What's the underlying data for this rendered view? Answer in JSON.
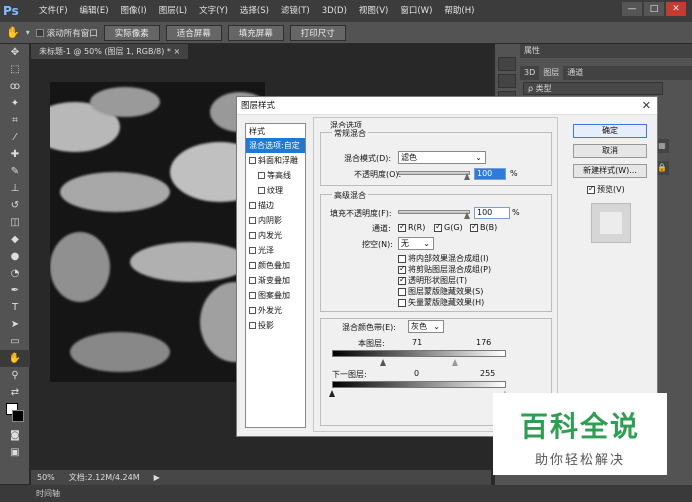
{
  "app": {
    "logo": "Ps"
  },
  "menu": [
    "文件(F)",
    "编辑(E)",
    "图像(I)",
    "图层(L)",
    "文字(Y)",
    "选择(S)",
    "滤镜(T)",
    "3D(D)",
    "视图(V)",
    "窗口(W)",
    "帮助(H)"
  ],
  "window_buttons": {
    "minimize": "—",
    "maximize": "□",
    "close": "✕"
  },
  "options_bar": {
    "scroll_all_label": "滚动所有窗口",
    "buttons": [
      "实际像素",
      "适合屏幕",
      "填充屏幕",
      "打印尺寸"
    ]
  },
  "document": {
    "tab": "未标题-1 @ 50% (图层 1, RGB/8) *  ×"
  },
  "status": {
    "zoom": "50%",
    "doc": "文档:2.12M/4.24M"
  },
  "bottom": {
    "timeline": "时间轴"
  },
  "right_panel": {
    "tab_top": "属性",
    "tabs": [
      "3D",
      "图层",
      "通道"
    ],
    "filter_placeholder": "ρ 类型"
  },
  "dialog": {
    "title": "图层样式",
    "close": "✕",
    "styles_header": "样式",
    "styles": [
      {
        "label": "混合选项:自定",
        "checked": null,
        "selected": true,
        "indent": false
      },
      {
        "label": "斜面和浮雕",
        "checked": false,
        "selected": false,
        "indent": false
      },
      {
        "label": "等高线",
        "checked": false,
        "selected": false,
        "indent": true
      },
      {
        "label": "纹理",
        "checked": false,
        "selected": false,
        "indent": true
      },
      {
        "label": "描边",
        "checked": false,
        "selected": false,
        "indent": false
      },
      {
        "label": "内阴影",
        "checked": false,
        "selected": false,
        "indent": false
      },
      {
        "label": "内发光",
        "checked": false,
        "selected": false,
        "indent": false
      },
      {
        "label": "光泽",
        "checked": false,
        "selected": false,
        "indent": false
      },
      {
        "label": "颜色叠加",
        "checked": false,
        "selected": false,
        "indent": false
      },
      {
        "label": "渐变叠加",
        "checked": false,
        "selected": false,
        "indent": false
      },
      {
        "label": "图案叠加",
        "checked": false,
        "selected": false,
        "indent": false
      },
      {
        "label": "外发光",
        "checked": false,
        "selected": false,
        "indent": false
      },
      {
        "label": "投影",
        "checked": false,
        "selected": false,
        "indent": false
      }
    ],
    "blend_options_title": "混合选项",
    "general_blend": "常规混合",
    "blend_mode_label": "混合模式(D):",
    "blend_mode_value": "滤色",
    "opacity_label": "不透明度(O):",
    "opacity_value": "100",
    "percent": "%",
    "advanced_blend": "高级混合",
    "fill_opacity_label": "填充不透明度(F):",
    "fill_opacity_value": "100",
    "channels_label": "通道:",
    "channels": [
      {
        "label": "R(R)",
        "checked": true
      },
      {
        "label": "G(G)",
        "checked": true
      },
      {
        "label": "B(B)",
        "checked": true
      }
    ],
    "knockout_label": "挖空(N):",
    "knockout_value": "无",
    "adv_checks": [
      {
        "label": "将内部效果混合成组(I)",
        "checked": false
      },
      {
        "label": "将剪贴图层混合成组(P)",
        "checked": true
      },
      {
        "label": "透明形状图层(T)",
        "checked": true
      },
      {
        "label": "图层蒙版隐藏效果(S)",
        "checked": false
      },
      {
        "label": "矢量蒙版隐藏效果(H)",
        "checked": false
      }
    ],
    "blend_if_label": "混合颜色带(E):",
    "blend_if_value": "灰色",
    "this_layer_label": "本图层:",
    "this_layer_low": "71",
    "this_layer_high": "176",
    "underlying_label": "下一图层:",
    "underlying_low": "0",
    "underlying_high": "255",
    "buttons": {
      "ok": "确定",
      "cancel": "取消",
      "new_style": "新建样式(W)...",
      "preview": "预览(V)"
    },
    "preview_checked": true
  },
  "watermark": {
    "title": "百科全说",
    "subtitle": "助你轻松解决"
  },
  "colors": {
    "accent": "#1e78d6",
    "watermark_green": "#2e9e52",
    "ps_logo": "#7fbfff"
  }
}
